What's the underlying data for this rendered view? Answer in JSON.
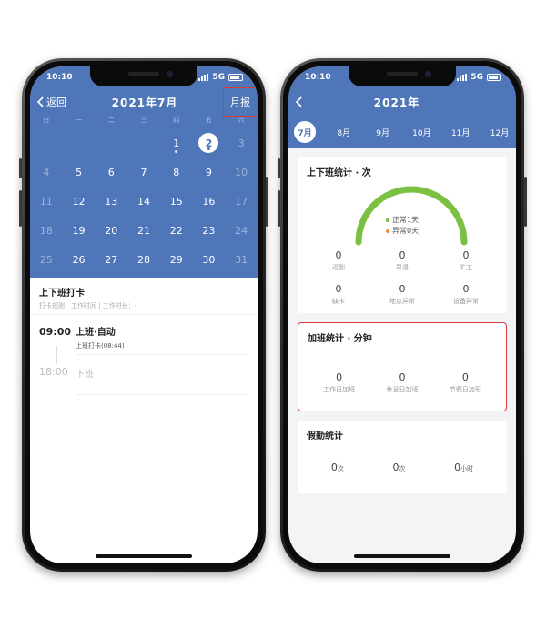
{
  "left": {
    "status": {
      "time": "10:10",
      "network": "5G"
    },
    "nav": {
      "back_label": "返回",
      "title": "2021年7月",
      "report_label": "月报"
    },
    "weekdays": [
      "日",
      "一",
      "二",
      "三",
      "四",
      "五",
      "六"
    ],
    "calendar": [
      {
        "d": "",
        "t": "blank"
      },
      {
        "d": "",
        "t": "blank"
      },
      {
        "d": "",
        "t": "blank"
      },
      {
        "d": "",
        "t": "blank"
      },
      {
        "d": "1",
        "t": "dot"
      },
      {
        "d": "2",
        "t": "sel"
      },
      {
        "d": "3",
        "t": "dim"
      },
      {
        "d": "4",
        "t": "dim"
      },
      {
        "d": "5",
        "t": ""
      },
      {
        "d": "6",
        "t": ""
      },
      {
        "d": "7",
        "t": ""
      },
      {
        "d": "8",
        "t": ""
      },
      {
        "d": "9",
        "t": ""
      },
      {
        "d": "10",
        "t": "dim"
      },
      {
        "d": "11",
        "t": "dim"
      },
      {
        "d": "12",
        "t": ""
      },
      {
        "d": "13",
        "t": ""
      },
      {
        "d": "14",
        "t": ""
      },
      {
        "d": "15",
        "t": ""
      },
      {
        "d": "16",
        "t": ""
      },
      {
        "d": "17",
        "t": "dim"
      },
      {
        "d": "18",
        "t": "dim"
      },
      {
        "d": "19",
        "t": ""
      },
      {
        "d": "20",
        "t": ""
      },
      {
        "d": "21",
        "t": ""
      },
      {
        "d": "22",
        "t": ""
      },
      {
        "d": "23",
        "t": ""
      },
      {
        "d": "24",
        "t": "dim"
      },
      {
        "d": "25",
        "t": "dim"
      },
      {
        "d": "26",
        "t": ""
      },
      {
        "d": "27",
        "t": ""
      },
      {
        "d": "28",
        "t": ""
      },
      {
        "d": "29",
        "t": ""
      },
      {
        "d": "30",
        "t": ""
      },
      {
        "d": "31",
        "t": "dim"
      }
    ],
    "section_title": "上下班打卡",
    "section_sub": "打卡规则：工作时间 | 工作时长：-",
    "timeline": [
      {
        "time": "09:00",
        "title": "上班·自动",
        "sub": "上班打卡(08:44)"
      },
      {
        "time": "18:00",
        "title": "下班",
        "sub": ""
      }
    ]
  },
  "right": {
    "status": {
      "time": "10:10",
      "network": "5G"
    },
    "nav": {
      "title": "2021年"
    },
    "months": [
      "7月",
      "8月",
      "9月",
      "10月",
      "11月",
      "12月"
    ],
    "attendance": {
      "title": "上下班统计 · 次",
      "legend": [
        "正常1天",
        "异常0天"
      ],
      "stats": [
        {
          "value": "0",
          "label": "迟到"
        },
        {
          "value": "0",
          "label": "早退"
        },
        {
          "value": "0",
          "label": "旷工"
        },
        {
          "value": "0",
          "label": "缺卡"
        },
        {
          "value": "0",
          "label": "地点异常"
        },
        {
          "value": "0",
          "label": "设备异常"
        }
      ]
    },
    "overtime": {
      "title": "加班统计 · 分钟",
      "stats": [
        {
          "value": "0",
          "label": "工作日加班"
        },
        {
          "value": "0",
          "label": "休息日加班"
        },
        {
          "value": "0",
          "label": "节假日加班"
        }
      ]
    },
    "leave": {
      "title": "假勤统计",
      "items": [
        {
          "value": "0",
          "unit": "次"
        },
        {
          "value": "0",
          "unit": "次"
        },
        {
          "value": "0",
          "unit": "小时"
        }
      ]
    }
  },
  "colors": {
    "primary": "#4f76b9",
    "highlight": "#d83a3a",
    "normal": "#7ac143",
    "abnormal": "#f08a3c"
  }
}
